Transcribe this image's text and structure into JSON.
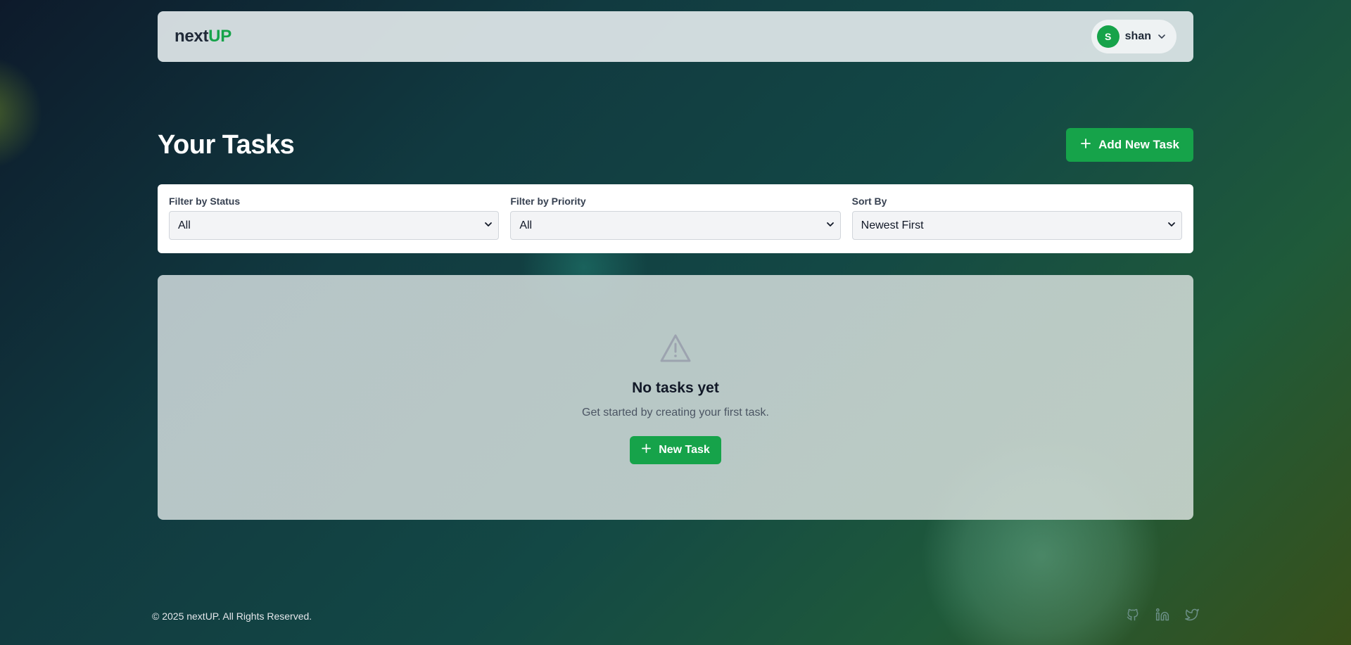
{
  "header": {
    "logo_part1": "next",
    "logo_part2": "UP",
    "user": {
      "initial": "S",
      "name": "shan"
    }
  },
  "main": {
    "title": "Your Tasks",
    "add_button_label": "Add New Task"
  },
  "filters": {
    "status": {
      "label": "Filter by Status",
      "value": "All"
    },
    "priority": {
      "label": "Filter by Priority",
      "value": "All"
    },
    "sort": {
      "label": "Sort By",
      "value": "Newest First"
    }
  },
  "empty_state": {
    "title": "No tasks yet",
    "subtitle": "Get started by creating your first task.",
    "button_label": "New Task",
    "icon": "warning-triangle-icon"
  },
  "footer": {
    "copyright": "© 2025 nextUP. All Rights Reserved.",
    "social_icons": [
      "github-icon",
      "linkedin-icon",
      "twitter-icon"
    ]
  },
  "colors": {
    "accent": "#16a34a",
    "text_dark": "#1f2937"
  }
}
